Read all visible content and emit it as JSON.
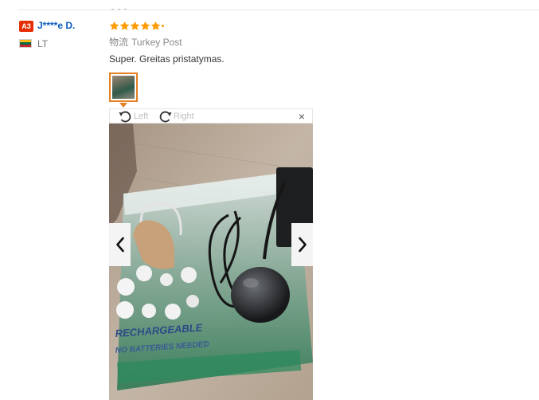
{
  "review": {
    "badge": "A3",
    "reviewer_name": "J****e D.",
    "country": "LT",
    "rating": 5,
    "shipping_label": "物流",
    "shipping_method": "Turkey Post",
    "text": "Super. Greitas pristatymas."
  },
  "viewer": {
    "rotate_left_label": "Left",
    "rotate_right_label": "Right",
    "close_label": "×",
    "photo_print_1": "RECHARGEABLE",
    "photo_print_2": "NO BATTERIES NEEDED"
  },
  "colors": {
    "accent": "#e67e22",
    "star": "#ff9a00",
    "badge": "#e62e04",
    "name": "#0a5cbf"
  },
  "icons": [
    "star-icon",
    "lithuania-flag-icon",
    "rotate-left-icon",
    "rotate-right-icon",
    "close-icon",
    "chevron-left-icon",
    "chevron-right-icon"
  ]
}
